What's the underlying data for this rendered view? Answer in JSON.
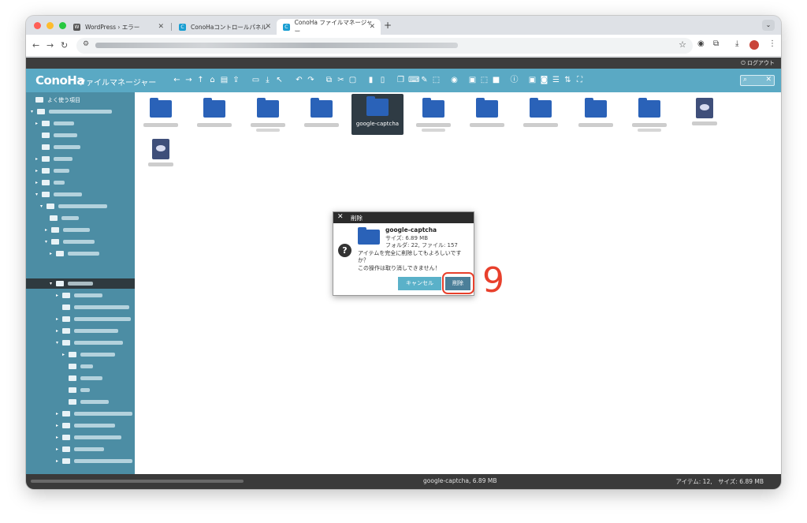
{
  "browser": {
    "tabs": [
      {
        "label": "WordPress › エラー",
        "icon": "wordpress-favicon"
      },
      {
        "label": "ConoHaコントロールパネル",
        "icon": "conoha-favicon"
      },
      {
        "label": "ConoHa ファイルマネージャー",
        "icon": "conoha-favicon",
        "active": true
      }
    ],
    "new_tab": "+",
    "tab_menu": "⌄"
  },
  "app": {
    "logout": "⏻ ログアウト",
    "logo": "ConoHa",
    "title": "ファイルマネージャー",
    "search_icon": "⌕",
    "search_clear": "✕"
  },
  "sidebar": {
    "favorites": "よく使う項目"
  },
  "files": [
    {
      "type": "folder",
      "name": "google-captcha",
      "selected": true
    }
  ],
  "status": {
    "selection": "google-captcha, 6.89 MB",
    "summary": "アイテム: 12,　サイズ: 6.89 MB"
  },
  "dialog": {
    "close": "✕",
    "title": "削除",
    "item_name": "google-captcha",
    "item_size": "サイズ: 6.89 MB",
    "item_count": "フォルダ: 22, ファイル: 157",
    "question_icon": "?",
    "message": "アイテムを完全に削除してもよろしいですか？",
    "warning": "この操作は取り消しできません！",
    "cancel_label": "キャンセル",
    "delete_label": "削除"
  },
  "annotation": {
    "step": "9",
    "color": "#e8402c"
  },
  "colors": {
    "appbar": "#5aa9c4",
    "sidebar": "#4c8da4",
    "folder": "#2a62b8"
  }
}
